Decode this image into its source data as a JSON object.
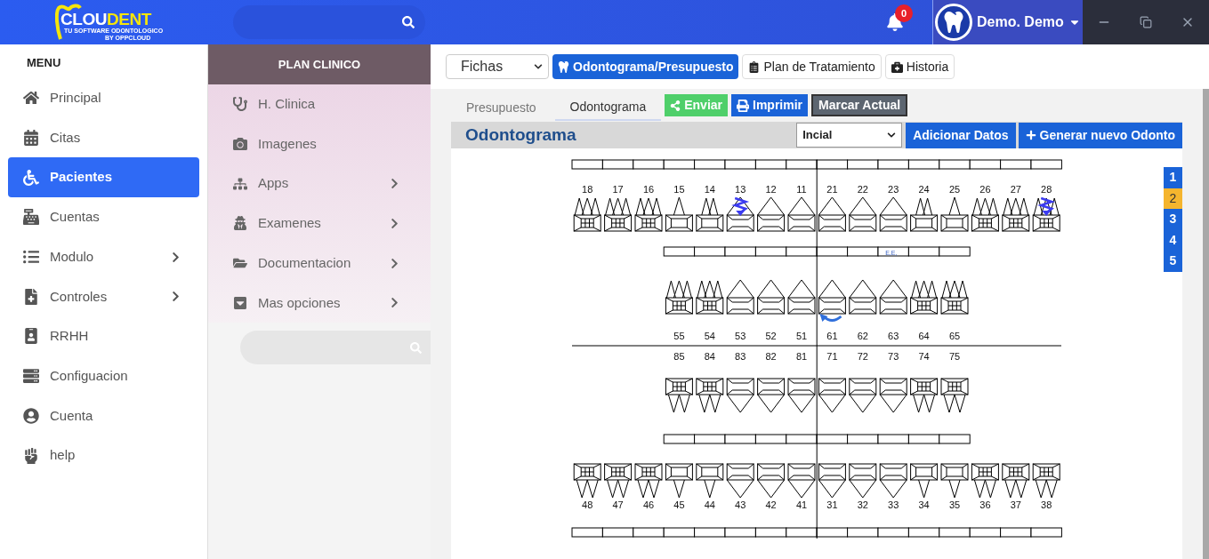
{
  "logo": {
    "name_a": "CLOU",
    "name_b": "DENT",
    "tagline": "TU SOFTWARE ODONTOLOGICO",
    "byline": "BY OPPCLOUD"
  },
  "topbar": {
    "notifications": "0",
    "user": "Demo. Demo"
  },
  "menu": {
    "title": "MENU",
    "items": [
      {
        "label": "Principal",
        "selected": false,
        "submenu": false
      },
      {
        "label": "Citas",
        "selected": false,
        "submenu": false
      },
      {
        "label": "Pacientes",
        "selected": true,
        "submenu": false
      },
      {
        "label": "Cuentas",
        "selected": false,
        "submenu": false
      },
      {
        "label": "Modulo",
        "selected": false,
        "submenu": true
      },
      {
        "label": "Controles",
        "selected": false,
        "submenu": true
      },
      {
        "label": "RRHH",
        "selected": false,
        "submenu": false
      },
      {
        "label": "Configuacion",
        "selected": false,
        "submenu": false
      },
      {
        "label": "Cuenta",
        "selected": false,
        "submenu": false
      },
      {
        "label": "help",
        "selected": false,
        "submenu": false
      }
    ]
  },
  "plan": {
    "title": "PLAN CLINICO",
    "items": [
      {
        "label": "H. Clinica",
        "submenu": false
      },
      {
        "label": "Imagenes",
        "submenu": false
      },
      {
        "label": "Apps",
        "submenu": true
      },
      {
        "label": "Examenes",
        "submenu": true
      },
      {
        "label": "Documentacion",
        "submenu": true
      },
      {
        "label": "Mas opciones",
        "submenu": true
      }
    ]
  },
  "toolbar": {
    "select": "Fichas",
    "buttons": [
      {
        "label": "Odontograma/Presupuesto",
        "selected": true
      },
      {
        "label": "Plan de Tratamiento",
        "selected": false
      },
      {
        "label": "Historia",
        "selected": false
      }
    ]
  },
  "tabs": [
    {
      "label": "Presupuesto",
      "selected": false
    },
    {
      "label": "Odontograma",
      "selected": true
    }
  ],
  "actions": [
    {
      "label": "Enviar",
      "kind": "share"
    },
    {
      "label": "Imprimir",
      "kind": "print"
    },
    {
      "label": "Marcar Actual",
      "kind": "mark"
    }
  ],
  "card": {
    "title": "Odontograma",
    "select": "Incial",
    "buttons": [
      {
        "label": "Adicionar Datos",
        "kind": "plain"
      },
      {
        "label": "Generar nuevo Odonto",
        "kind": "add"
      }
    ]
  },
  "pages": [
    {
      "label": "1",
      "selected": false
    },
    {
      "label": "2",
      "selected": true
    },
    {
      "label": "3",
      "selected": false
    },
    {
      "label": "4",
      "selected": false
    },
    {
      "label": "5",
      "selected": false
    }
  ],
  "odontogram": {
    "rows": [
      {
        "teeth": [
          {
            "number": "18",
            "kind": "molar3",
            "zigzag": false,
            "rotation": false
          },
          {
            "number": "17",
            "kind": "molar3",
            "zigzag": false,
            "rotation": false
          },
          {
            "number": "16",
            "kind": "molar3",
            "zigzag": false,
            "rotation": false
          },
          {
            "number": "15",
            "kind": "premolar",
            "zigzag": false,
            "rotation": false
          },
          {
            "number": "14",
            "kind": "premolar2",
            "zigzag": false,
            "rotation": false
          },
          {
            "number": "13",
            "kind": "anterior",
            "zigzag": true,
            "rotation": false
          },
          {
            "number": "12",
            "kind": "anterior",
            "zigzag": false,
            "rotation": false
          },
          {
            "number": "11",
            "kind": "anterior",
            "zigzag": false,
            "rotation": false
          },
          {
            "number": "21",
            "kind": "anterior",
            "zigzag": false,
            "rotation": false
          },
          {
            "number": "22",
            "kind": "anterior",
            "zigzag": false,
            "rotation": false
          },
          {
            "number": "23",
            "kind": "anterior",
            "zigzag": false,
            "rotation": false
          },
          {
            "number": "24",
            "kind": "premolar2",
            "zigzag": false,
            "rotation": false
          },
          {
            "number": "25",
            "kind": "premolar",
            "zigzag": false,
            "rotation": false
          },
          {
            "number": "26",
            "kind": "molar3",
            "zigzag": false,
            "rotation": false
          },
          {
            "number": "27",
            "kind": "molar3",
            "zigzag": false,
            "rotation": false
          },
          {
            "number": "28",
            "kind": "molar3",
            "zigzag": true,
            "rotation": false
          }
        ]
      },
      {
        "teeth": [
          {
            "number": "55",
            "kind": "molar3",
            "zigzag": false,
            "rotation": false
          },
          {
            "number": "54",
            "kind": "molar3",
            "zigzag": false,
            "rotation": false
          },
          {
            "number": "53",
            "kind": "anterior",
            "zigzag": false,
            "rotation": false
          },
          {
            "number": "52",
            "kind": "anterior",
            "zigzag": false,
            "rotation": false
          },
          {
            "number": "51",
            "kind": "anterior",
            "zigzag": false,
            "rotation": false
          },
          {
            "number": "61",
            "kind": "anterior",
            "zigzag": false,
            "rotation": true
          },
          {
            "number": "62",
            "kind": "anterior",
            "zigzag": false,
            "rotation": false
          },
          {
            "number": "63",
            "kind": "anterior",
            "zigzag": false,
            "rotation": false,
            "note": "E,E,"
          },
          {
            "number": "64",
            "kind": "molar3",
            "zigzag": false,
            "rotation": false
          },
          {
            "number": "65",
            "kind": "molar3",
            "zigzag": false,
            "rotation": false
          }
        ]
      },
      {
        "teeth": [
          {
            "number": "85",
            "kind": "molar2",
            "zigzag": false,
            "rotation": false
          },
          {
            "number": "84",
            "kind": "molar2",
            "zigzag": false,
            "rotation": false
          },
          {
            "number": "83",
            "kind": "anterior",
            "zigzag": false,
            "rotation": false
          },
          {
            "number": "82",
            "kind": "anterior",
            "zigzag": false,
            "rotation": false
          },
          {
            "number": "81",
            "kind": "anterior",
            "zigzag": false,
            "rotation": false
          },
          {
            "number": "71",
            "kind": "anterior",
            "zigzag": false,
            "rotation": false
          },
          {
            "number": "72",
            "kind": "anterior",
            "zigzag": false,
            "rotation": false
          },
          {
            "number": "73",
            "kind": "anterior",
            "zigzag": false,
            "rotation": false
          },
          {
            "number": "74",
            "kind": "molar2",
            "zigzag": false,
            "rotation": false
          },
          {
            "number": "75",
            "kind": "molar2",
            "zigzag": false,
            "rotation": false
          }
        ]
      },
      {
        "teeth": [
          {
            "number": "48",
            "kind": "molar2",
            "zigzag": false,
            "rotation": false
          },
          {
            "number": "47",
            "kind": "molar2",
            "zigzag": false,
            "rotation": false
          },
          {
            "number": "46",
            "kind": "molar2",
            "zigzag": false,
            "rotation": false
          },
          {
            "number": "45",
            "kind": "premolar",
            "zigzag": false,
            "rotation": false
          },
          {
            "number": "44",
            "kind": "premolar",
            "zigzag": false,
            "rotation": false
          },
          {
            "number": "43",
            "kind": "anterior",
            "zigzag": false,
            "rotation": false
          },
          {
            "number": "42",
            "kind": "anterior",
            "zigzag": false,
            "rotation": false
          },
          {
            "number": "41",
            "kind": "anterior",
            "zigzag": false,
            "rotation": false
          },
          {
            "number": "31",
            "kind": "anterior",
            "zigzag": false,
            "rotation": false
          },
          {
            "number": "32",
            "kind": "anterior",
            "zigzag": false,
            "rotation": false
          },
          {
            "number": "33",
            "kind": "anterior",
            "zigzag": false,
            "rotation": false
          },
          {
            "number": "34",
            "kind": "premolar",
            "zigzag": false,
            "rotation": false
          },
          {
            "number": "35",
            "kind": "premolar",
            "zigzag": false,
            "rotation": false
          },
          {
            "number": "36",
            "kind": "molar2",
            "zigzag": false,
            "rotation": false
          },
          {
            "number": "37",
            "kind": "molar2",
            "zigzag": false,
            "rotation": false
          },
          {
            "number": "38",
            "kind": "molar2",
            "zigzag": false,
            "rotation": false
          }
        ]
      }
    ]
  }
}
